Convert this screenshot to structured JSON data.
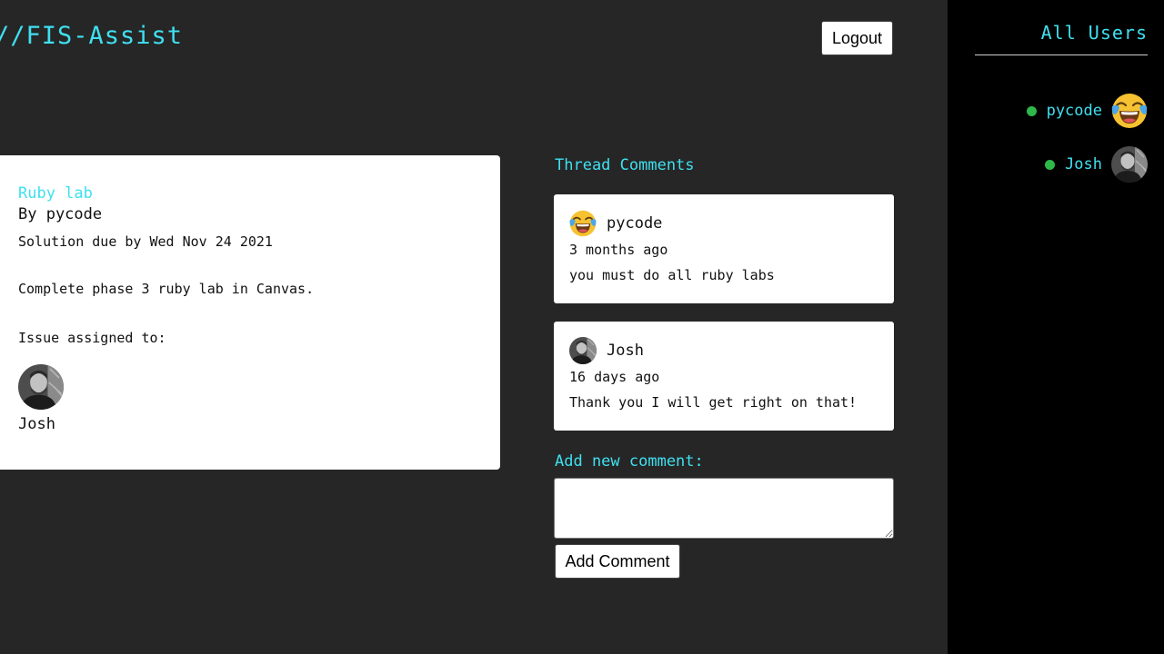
{
  "header": {
    "brand": "//FIS-Assist",
    "logout_label": "Logout"
  },
  "issue": {
    "title": "Ruby lab",
    "author": "By pycode",
    "due": "Solution due by Wed Nov 24 2021",
    "description": "Complete phase 3 ruby lab in Canvas.",
    "assigned_label": "Issue assigned to:",
    "assignee": {
      "name": "Josh",
      "avatar": "profile-photo"
    }
  },
  "comments_section": {
    "heading": "Thread Comments",
    "comments": [
      {
        "author": "pycode",
        "time": "3 months ago",
        "body": "you must do all ruby labs",
        "avatar": "tears-of-joy-emoji"
      },
      {
        "author": "Josh",
        "time": "16 days ago",
        "body": "Thank you I will get right on that!",
        "avatar": "profile-photo"
      }
    ]
  },
  "new_comment": {
    "label": "Add new comment:",
    "value": "",
    "button_label": "Add Comment"
  },
  "sidebar": {
    "title": "All Users",
    "users": [
      {
        "name": "pycode",
        "status": "online",
        "avatar": "tears-of-joy-emoji"
      },
      {
        "name": "Josh",
        "status": "online",
        "avatar": "profile-photo"
      }
    ]
  },
  "colors": {
    "accent": "#3fe0f0",
    "online": "#2fb84a",
    "background": "#262626",
    "sidebar_background": "#000000"
  }
}
